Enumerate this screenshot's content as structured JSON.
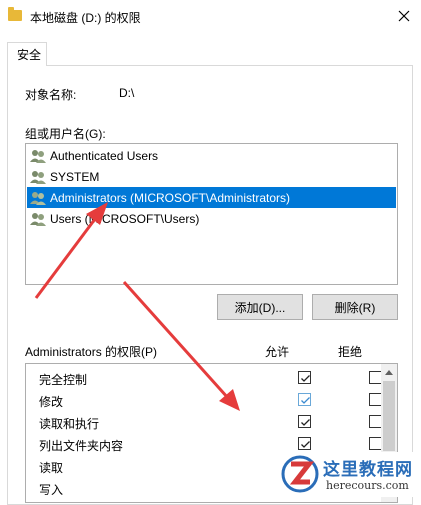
{
  "window": {
    "title": "本地磁盘 (D:) 的权限",
    "close_icon": "close-icon"
  },
  "tabs": [
    {
      "label": "安全"
    }
  ],
  "object": {
    "label": "对象名称:",
    "value": "D:\\"
  },
  "groups": {
    "label": "组或用户名(G):",
    "items": [
      {
        "name": "Authenticated Users",
        "selected": false
      },
      {
        "name": "SYSTEM",
        "selected": false
      },
      {
        "name": "Administrators (MICROSOFT\\Administrators)",
        "selected": true
      },
      {
        "name": "Users (MICROSOFT\\Users)",
        "selected": false
      }
    ]
  },
  "buttons": {
    "add": "添加(D)...",
    "remove": "删除(R)"
  },
  "permissions": {
    "title": "Administrators 的权限(P)",
    "allow_header": "允许",
    "deny_header": "拒绝",
    "rows": [
      {
        "name": "完全控制",
        "allow": true,
        "deny": false
      },
      {
        "name": "修改",
        "allow": true,
        "deny": false
      },
      {
        "name": "读取和执行",
        "allow": true,
        "deny": false
      },
      {
        "name": "列出文件夹内容",
        "allow": true,
        "deny": false
      },
      {
        "name": "读取",
        "allow": true,
        "deny": false
      },
      {
        "name": "写入",
        "allow": true,
        "deny": false
      }
    ]
  },
  "watermark": {
    "title": "这里教程网",
    "url": "herecours.com"
  },
  "colors": {
    "selection": "#0078d7",
    "annotation_arrow": "#e53c3c",
    "watermark_blue": "#2a6db8"
  }
}
